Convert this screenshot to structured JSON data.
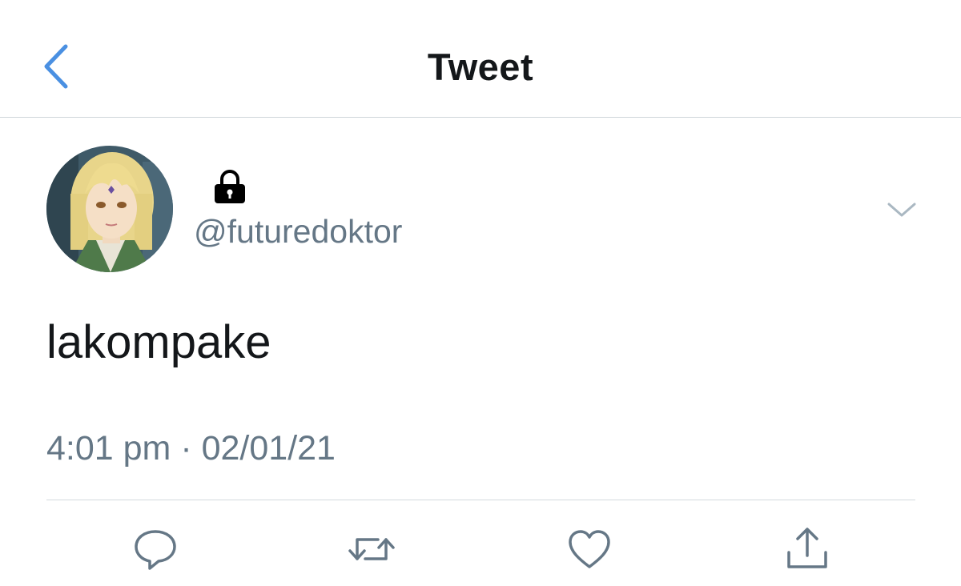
{
  "header": {
    "title": "Tweet",
    "back_icon": "chevron-left-icon"
  },
  "tweet": {
    "author": {
      "avatar_icon": "avatar",
      "protected_icon": "lock-icon",
      "handle": "@futuredoktor"
    },
    "text": "lakompake",
    "timestamp": "4:01 pm · 02/01/21",
    "menu_icon": "chevron-down-icon"
  },
  "actions": [
    {
      "icon": "reply-icon"
    },
    {
      "icon": "retweet-icon"
    },
    {
      "icon": "like-icon"
    },
    {
      "icon": "share-icon"
    }
  ],
  "colors": {
    "accent": "#4a90e2",
    "text_primary": "#14171a",
    "text_secondary": "#657786",
    "divider": "#cfd5da",
    "icon_gray": "#657786"
  }
}
